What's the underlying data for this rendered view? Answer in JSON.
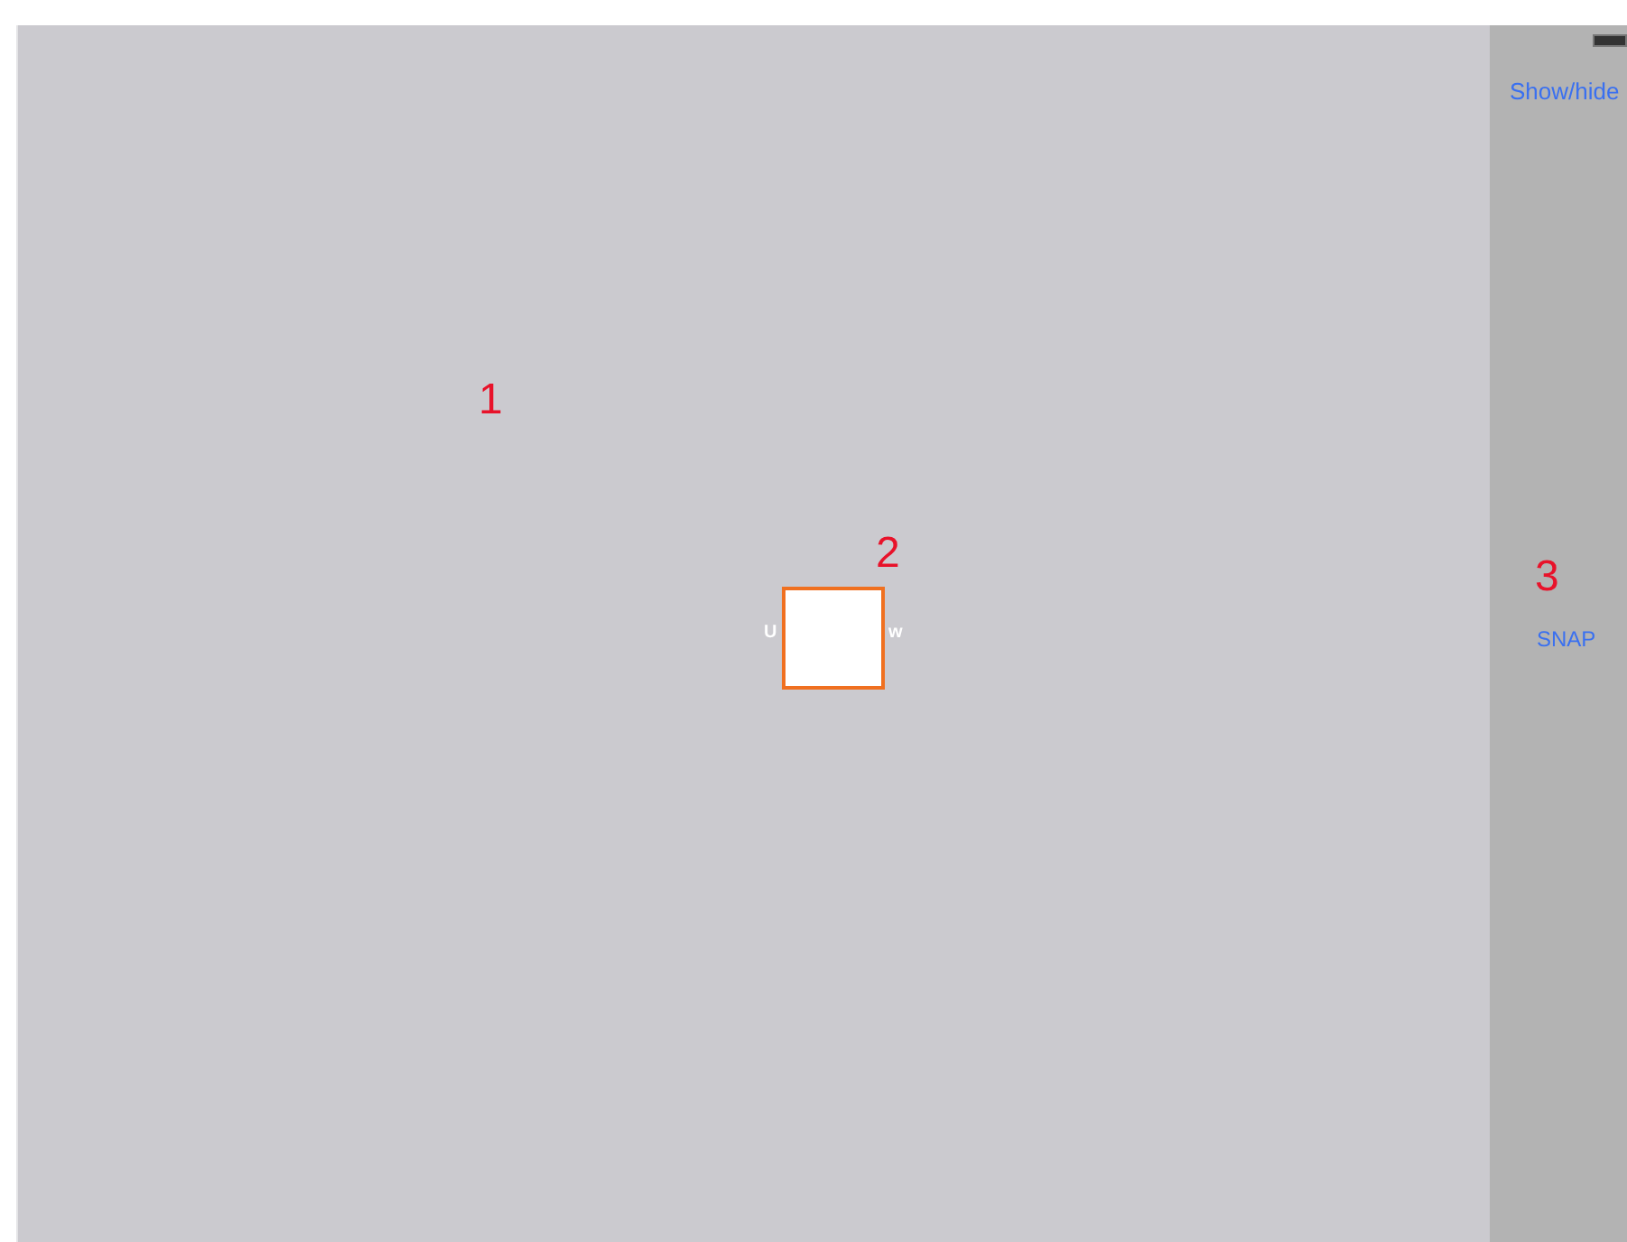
{
  "canvas": {
    "markers": [
      {
        "label": "1"
      },
      {
        "label": "2"
      },
      {
        "label": "3"
      }
    ],
    "view": {
      "left_text": "U",
      "right_text": "w"
    }
  },
  "sidebar": {
    "toggle_label": "Show/hide",
    "snap_label": "SNAP"
  }
}
